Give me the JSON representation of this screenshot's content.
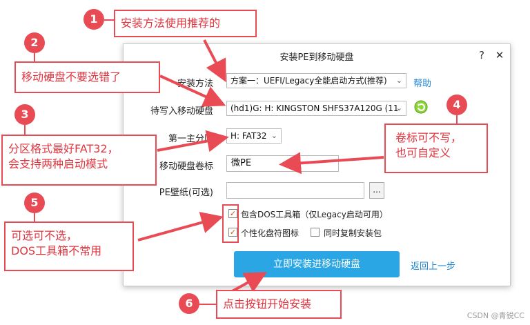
{
  "dialog": {
    "title": "安装PE到移动硬盘",
    "help_btn": "?",
    "close_btn": "✕",
    "fields": {
      "method_label": "安装方法",
      "method_value": "方案一：UEFI/Legacy全能启动方式(推荐)",
      "method_help": "帮助",
      "disk_label": "待写入移动硬盘",
      "disk_value": "(hd1)G: H: KINGSTON  SHFS37A120G (11",
      "partition_label": "第一主分区",
      "partition_value": "H: FAT32",
      "volume_label": "移动硬盘卷标",
      "volume_value": "微PE",
      "wallpaper_label": "PE壁纸(可选)",
      "wallpaper_value": "",
      "browse_btn": "...",
      "dos_tools": "包含DOS工具箱（仅Legacy启动可用）",
      "custom_icon": "个性化盘符图标",
      "copy_installer": "同时复制安装包"
    },
    "install_btn": "立即安装进移动硬盘",
    "back_link": "返回上一步"
  },
  "annotations": [
    {
      "num": "1",
      "text": "安装方法使用推荐的"
    },
    {
      "num": "2",
      "text": "移动硬盘不要选错了"
    },
    {
      "num": "3",
      "line1": "分区格式最好FAT32，",
      "line2": "会支持两种启动模式"
    },
    {
      "num": "4",
      "line1": "卷标可不写，",
      "line2": "也可自定义"
    },
    {
      "num": "5",
      "line1": "可选可不选，",
      "line2": "DOS工具箱不常用"
    },
    {
      "num": "6",
      "text": "点击按钮开始安装"
    }
  ],
  "watermark": "CSDN @青锐CC",
  "colors": {
    "accent_red": "#e94b55",
    "button_blue": "#2aa6e4",
    "link_blue": "#1c86d6"
  }
}
